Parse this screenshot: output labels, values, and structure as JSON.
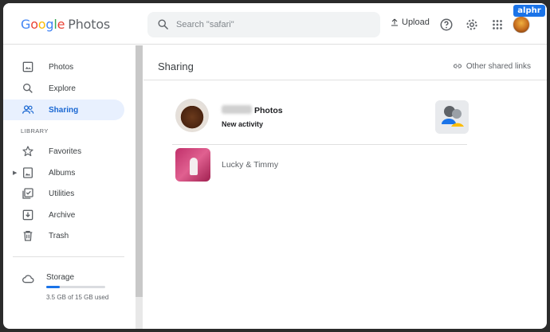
{
  "header": {
    "logo_google": "Google",
    "logo_product": "Photos",
    "search_placeholder": "Search \"safari\"",
    "upload_label": "Upload",
    "watermark": "alphr"
  },
  "sidebar": {
    "items": [
      {
        "label": "Photos",
        "icon": "photo-icon"
      },
      {
        "label": "Explore",
        "icon": "search-icon"
      },
      {
        "label": "Sharing",
        "icon": "people-icon",
        "active": true
      }
    ],
    "library_label": "LIBRARY",
    "library_items": [
      {
        "label": "Favorites",
        "icon": "star-icon"
      },
      {
        "label": "Albums",
        "icon": "album-icon"
      },
      {
        "label": "Utilities",
        "icon": "checklist-icon"
      },
      {
        "label": "Archive",
        "icon": "archive-icon"
      },
      {
        "label": "Trash",
        "icon": "trash-icon"
      }
    ],
    "storage": {
      "label": "Storage",
      "usage_text": "3.5 GB of 15 GB used",
      "fraction_used": 0.233
    }
  },
  "main": {
    "title": "Sharing",
    "other_links_label": "Other shared links",
    "rows": [
      {
        "title": "Photos",
        "subtitle": "New activity"
      },
      {
        "title": "Lucky & Timmy"
      }
    ]
  },
  "colors": {
    "accent": "#1a73e8",
    "active_bg": "#e8f0fe",
    "active_text": "#1967d2"
  }
}
